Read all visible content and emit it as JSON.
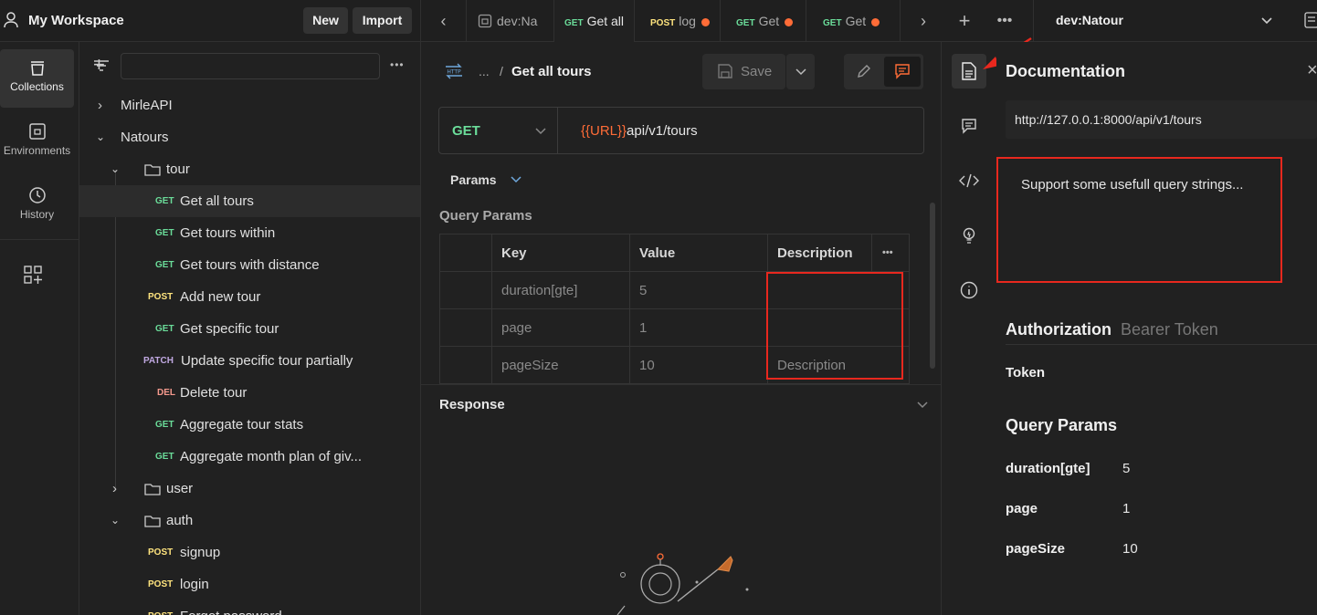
{
  "workspace": {
    "title": "My Workspace",
    "new_label": "New",
    "import_label": "Import"
  },
  "tabs": [
    {
      "method": "",
      "label": "dev:Na"
    },
    {
      "method": "GET",
      "label": "Get all"
    },
    {
      "method": "POST",
      "label": "log"
    },
    {
      "method": "GET",
      "label": "Get"
    },
    {
      "method": "GET",
      "label": "Get"
    }
  ],
  "environment": {
    "name": "dev:Natour"
  },
  "rail": {
    "collections": "Collections",
    "environments": "Environments",
    "history": "History"
  },
  "tree": {
    "mirle": "MirleAPI",
    "natours": "Natours",
    "tour_folder": "tour",
    "user_folder": "user",
    "auth_folder": "auth",
    "tour_items": [
      {
        "method": "GET",
        "label": "Get all tours"
      },
      {
        "method": "GET",
        "label": "Get tours within"
      },
      {
        "method": "GET",
        "label": "Get tours with distance"
      },
      {
        "method": "POST",
        "label": "Add new tour"
      },
      {
        "method": "GET",
        "label": "Get specific tour"
      },
      {
        "method": "PATCH",
        "label": "Update specific tour partially"
      },
      {
        "method": "DEL",
        "label": "Delete tour"
      },
      {
        "method": "GET",
        "label": "Aggregate tour stats"
      },
      {
        "method": "GET",
        "label": "Aggregate month plan of giv..."
      }
    ],
    "auth_items": [
      {
        "method": "POST",
        "label": "signup"
      },
      {
        "method": "POST",
        "label": "login"
      },
      {
        "method": "POST",
        "label": "Forgot password"
      }
    ]
  },
  "request": {
    "breadcrumb_dots": "...",
    "name": "Get all tours",
    "save_label": "Save",
    "method": "GET",
    "url_var": "{{URL}}",
    "url_path": "api/v1/tours",
    "params_tab": "Params",
    "query_params_title": "Query Params",
    "columns": [
      "Key",
      "Value",
      "Description"
    ],
    "params": [
      {
        "key": "duration[gte]",
        "value": "5",
        "description": ""
      },
      {
        "key": "page",
        "value": "1",
        "description": ""
      },
      {
        "key": "pageSize",
        "value": "10",
        "description": "Description"
      }
    ],
    "response_label": "Response"
  },
  "docs": {
    "title": "Documentation",
    "url": "http://127.0.0.1:8000/api/v1/tours",
    "description": "Support some usefull query strings...",
    "auth_label": "Authorization",
    "auth_type": "Bearer Token",
    "token_label": "Token",
    "query_params_label": "Query Params",
    "params": [
      {
        "key": "duration[gte]",
        "value": "5"
      },
      {
        "key": "page",
        "value": "1"
      },
      {
        "key": "pageSize",
        "value": "10"
      }
    ]
  },
  "colors": {
    "accent": "#ff6c37",
    "get": "#6bdd9a",
    "post": "#ffe47e",
    "patch": "#c0a8e1",
    "del": "#f79a8e",
    "highlight": "#e8281e"
  }
}
